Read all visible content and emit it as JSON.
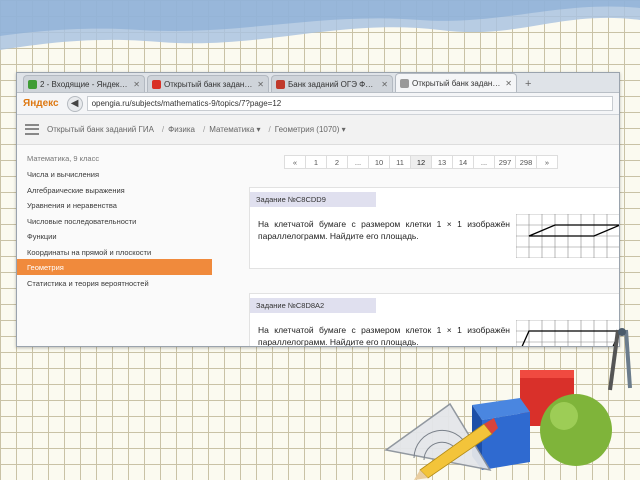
{
  "browser": {
    "tabs": [
      {
        "label": "2 - Входящие - Яндекс.П...",
        "color": "#3f9c35",
        "active": false
      },
      {
        "label": "Открытый банк заданий ...",
        "color": "#d93025",
        "active": false
      },
      {
        "label": "Банк заданий ОГЭ ФИПИ ...",
        "color": "#c0392b",
        "active": false
      },
      {
        "label": "Открытый банк заданий ГИА ...",
        "color": "#999999",
        "active": true
      }
    ],
    "new_tab": "+",
    "logo": "Яндекс",
    "url": "opengia.ru/subjects/mathematics-9/topics/7?page=12"
  },
  "site_nav": {
    "crumbs": [
      "Открытый банк заданий ГИА",
      "Физика",
      "Математика ▾",
      "Геометрия (1070) ▾"
    ]
  },
  "sidebar": {
    "heading": "Математика, 9 класс",
    "items": [
      {
        "label": "Числа и вычисления",
        "active": false
      },
      {
        "label": "Алгебраические выражения",
        "active": false
      },
      {
        "label": "Уравнения и неравенства",
        "active": false
      },
      {
        "label": "Числовые последовательности",
        "active": false
      },
      {
        "label": "Функции",
        "active": false
      },
      {
        "label": "Координаты на прямой и плоскости",
        "active": false
      },
      {
        "label": "Геометрия",
        "active": true
      },
      {
        "label": "Статистика и теория вероятностей",
        "active": false
      }
    ]
  },
  "pagination": {
    "pages": [
      "«",
      "1",
      "2",
      "...",
      "10",
      "11",
      "12",
      "13",
      "14",
      "...",
      "297",
      "298",
      "»"
    ],
    "current": "12"
  },
  "tasks": [
    {
      "title": "Задание №C8CDD9",
      "text": "На клетчатой бумаге с размером клетки 1 × 1 изображён параллелограмм. Найдите его площадь."
    },
    {
      "title": "Задание №C8D8A2",
      "text": "На клетчатой бумаге с размером клеток 1 × 1 изображён параллелограмм. Найдите его площадь."
    }
  ],
  "colors": {
    "accent_orange": "#f08a3c",
    "task_header_bg": "#e0e0ef",
    "wave_blue": "#aac3e0"
  },
  "icons": [
    "back-arrow-icon",
    "menu-icon",
    "ruler-icon",
    "protractor-icon",
    "pencil-icon",
    "cube-icon",
    "ball-icon",
    "compass-icon"
  ]
}
